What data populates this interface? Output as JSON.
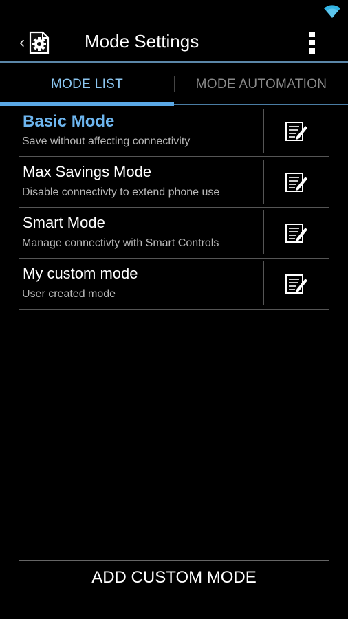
{
  "actionbar": {
    "title": "Mode Settings",
    "back_glyph": "‹"
  },
  "icons": {
    "status": "wifi-icon",
    "app": "settings-gear-icon",
    "menu": "overflow-menu-icon",
    "edit": "edit-note-icon"
  },
  "tabs": [
    {
      "label": "MODE LIST",
      "selected": true
    },
    {
      "label": "MODE AUTOMATION",
      "selected": false
    }
  ],
  "modes": [
    {
      "title": "Basic Mode",
      "subtitle": "Save without affecting connectivity",
      "active": true
    },
    {
      "title": "Max Savings Mode",
      "subtitle": "Disable connectivty to extend phone use",
      "active": false
    },
    {
      "title": "Smart Mode",
      "subtitle": "Manage connectivty with Smart Controls",
      "active": false
    },
    {
      "title": "My custom mode",
      "subtitle": "User created mode",
      "active": false
    }
  ],
  "footer": {
    "add_label": "ADD CUSTOM MODE"
  },
  "colors": {
    "accent": "#5aa8e6",
    "active_title": "#6db5ee",
    "background": "#000000"
  }
}
